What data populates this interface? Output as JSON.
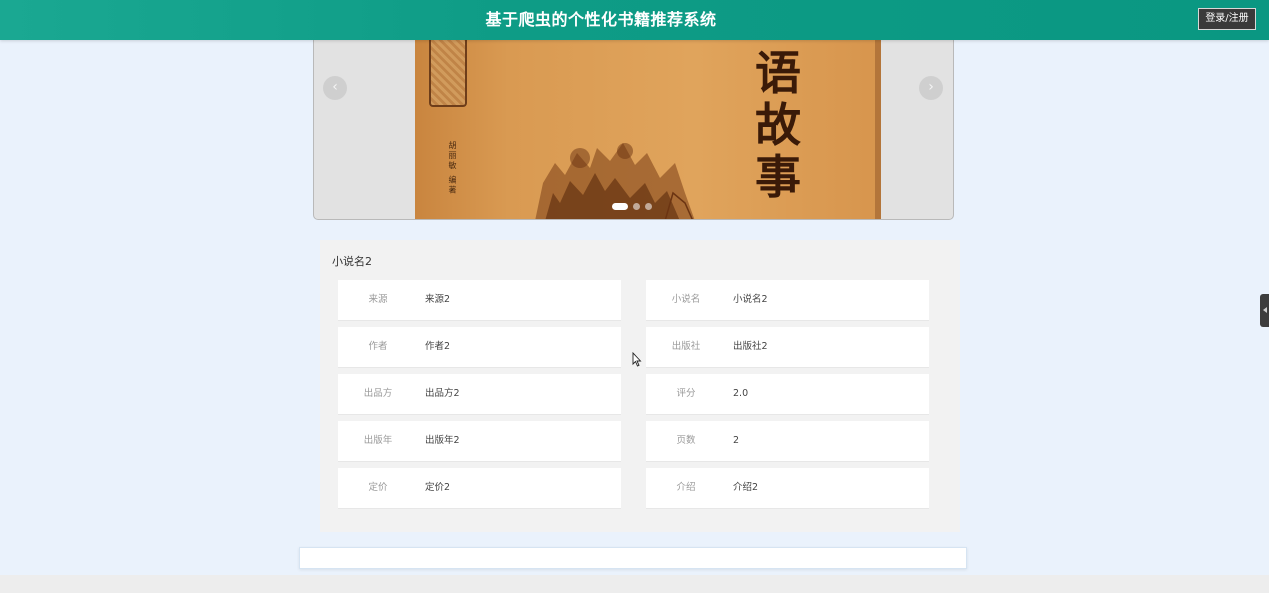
{
  "header": {
    "title": "基于爬虫的个性化书籍推荐系统",
    "login_label": "登录/注册"
  },
  "carousel": {
    "prev_glyph": "‹",
    "next_glyph": "›",
    "cover_chars": [
      "语",
      "故",
      "事"
    ],
    "cover_author_text": "胡丽敏 编著",
    "active_slide": 1,
    "slide_count": 3
  },
  "detail": {
    "book_name": "小说名2",
    "fields": [
      {
        "label": "来源",
        "value": "来源2"
      },
      {
        "label": "小说名",
        "value": "小说名2"
      },
      {
        "label": "作者",
        "value": "作者2"
      },
      {
        "label": "出版社",
        "value": "出版社2"
      },
      {
        "label": "出品方",
        "value": "出品方2"
      },
      {
        "label": "评分",
        "value": "2.0"
      },
      {
        "label": "出版年",
        "value": "出版年2"
      },
      {
        "label": "页数",
        "value": "2"
      },
      {
        "label": "定价",
        "value": "定价2"
      },
      {
        "label": "介绍",
        "value": "介绍2"
      }
    ]
  },
  "colors": {
    "header_bg": "#0e9c86",
    "page_bg": "#eaf2fc",
    "panel_bg": "#f2f2f2"
  }
}
